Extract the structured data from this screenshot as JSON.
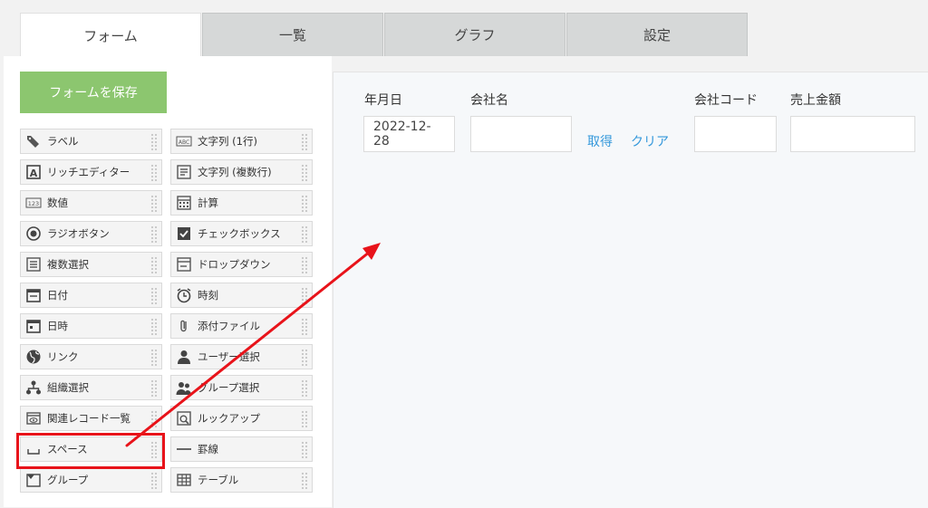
{
  "tabs": [
    {
      "label": "フォーム",
      "active": true
    },
    {
      "label": "一覧",
      "active": false
    },
    {
      "label": "グラフ",
      "active": false
    },
    {
      "label": "設定",
      "active": false
    }
  ],
  "palette": {
    "save_label": "フォームを保存",
    "left_items": [
      {
        "label": "ラベル",
        "icon": "label-icon"
      },
      {
        "label": "リッチエディター",
        "icon": "rich-editor-icon"
      },
      {
        "label": "数値",
        "icon": "number-icon"
      },
      {
        "label": "ラジオボタン",
        "icon": "radio-button-icon"
      },
      {
        "label": "複数選択",
        "icon": "multi-select-icon"
      },
      {
        "label": "日付",
        "icon": "calendar-icon"
      },
      {
        "label": "日時",
        "icon": "datetime-icon"
      },
      {
        "label": "リンク",
        "icon": "globe-icon"
      },
      {
        "label": "組織選択",
        "icon": "organization-icon"
      },
      {
        "label": "関連レコード一覧",
        "icon": "related-records-icon"
      },
      {
        "label": "スペース",
        "icon": "space-icon"
      },
      {
        "label": "グループ",
        "icon": "group-icon"
      }
    ],
    "right_items": [
      {
        "label": "文字列 (1行)",
        "icon": "text-single-icon"
      },
      {
        "label": "文字列 (複数行)",
        "icon": "text-multi-icon"
      },
      {
        "label": "計算",
        "icon": "calculator-icon"
      },
      {
        "label": "チェックボックス",
        "icon": "checkbox-icon"
      },
      {
        "label": "ドロップダウン",
        "icon": "dropdown-icon"
      },
      {
        "label": "時刻",
        "icon": "clock-icon"
      },
      {
        "label": "添付ファイル",
        "icon": "paperclip-icon"
      },
      {
        "label": "ユーザー選択",
        "icon": "user-icon"
      },
      {
        "label": "グループ選択",
        "icon": "users-icon"
      },
      {
        "label": "ルックアップ",
        "icon": "lookup-icon"
      },
      {
        "label": "罫線",
        "icon": "line-icon"
      },
      {
        "label": "テーブル",
        "icon": "table-icon"
      }
    ]
  },
  "form": {
    "date_label": "年月日",
    "date_value": "2022-12-28",
    "company_label": "会社名",
    "company_value": "",
    "fetch_link": "取得",
    "clear_link": "クリア",
    "code_label": "会社コード",
    "code_value": "",
    "sales_label": "売上金額",
    "sales_value": ""
  },
  "annotation_color": "#e8131a",
  "accent_color": "#8cc66f",
  "link_color": "#3498db"
}
